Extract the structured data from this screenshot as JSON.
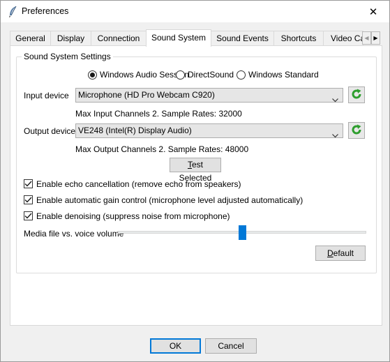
{
  "window": {
    "title": "Preferences",
    "close_glyph": "✕",
    "icon": "feather-quill-icon"
  },
  "tabs": [
    {
      "label": "General",
      "active": false
    },
    {
      "label": "Display",
      "active": false
    },
    {
      "label": "Connection",
      "active": false
    },
    {
      "label": "Sound System",
      "active": true
    },
    {
      "label": "Sound Events",
      "active": false
    },
    {
      "label": "Shortcuts",
      "active": false
    },
    {
      "label": "Video Cap",
      "active": false
    }
  ],
  "tab_scroll": {
    "left": "◀",
    "right": "▶"
  },
  "group": {
    "legend": "Sound System Settings",
    "sound_system_options": [
      {
        "label": "Windows Audio Session",
        "selected": true
      },
      {
        "label": "DirectSound",
        "selected": false
      },
      {
        "label": "Windows Standard",
        "selected": false
      }
    ],
    "input_device": {
      "label": "Input device",
      "value": "Microphone (HD Pro Webcam C920)",
      "info": "Max Input Channels 2. Sample Rates: 32000"
    },
    "output_device": {
      "label": "Output device",
      "value": "VE248 (Intel(R) Display Audio)",
      "info": "Max Output Channels 2. Sample Rates: 48000"
    },
    "test_button": {
      "prefix": "T",
      "rest": "est Selected"
    },
    "checkboxes": [
      {
        "label": "Enable echo cancellation (remove echo from speakers)",
        "checked": true
      },
      {
        "label": "Enable automatic gain control (microphone level adjusted automatically)",
        "checked": true
      },
      {
        "label": "Enable denoising (suppress noise from microphone)",
        "checked": true
      }
    ],
    "volume_slider": {
      "label": "Media file vs. voice volume",
      "value": 0.5
    },
    "default_button": {
      "prefix": "D",
      "rest": "efault"
    }
  },
  "footer": {
    "ok_label": "OK",
    "cancel_label": "Cancel"
  },
  "colors": {
    "accent": "#0078d7",
    "refresh_green": "#2e9e2e"
  }
}
